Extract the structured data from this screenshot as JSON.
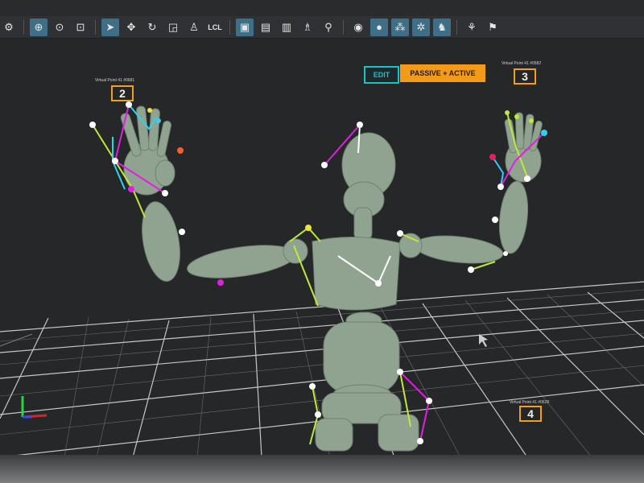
{
  "toolbar": {
    "items": [
      {
        "icon": "joint-icon"
      },
      {
        "icon": "zoom-icon",
        "active": true
      },
      {
        "icon": "zoom-selection-icon"
      },
      {
        "icon": "zoom-fit-icon"
      },
      {
        "icon": "select-arrow-icon",
        "active": true
      },
      {
        "icon": "move-icon"
      },
      {
        "icon": "rotate-icon"
      },
      {
        "icon": "scale-icon"
      },
      {
        "icon": "pose-icon"
      }
    ],
    "lcl_label": "LCL",
    "right_items": [
      {
        "icon": "layer-icon",
        "active": true
      },
      {
        "icon": "layer-lock-icon"
      },
      {
        "icon": "layer-edit-icon"
      },
      {
        "icon": "figure-icon"
      },
      {
        "icon": "link-icon"
      },
      {
        "icon": "eye-icon"
      },
      {
        "icon": "marker-icon",
        "active": true
      },
      {
        "icon": "marker-group-icon",
        "active": true
      },
      {
        "icon": "network-icon",
        "active": true
      },
      {
        "icon": "character-icon",
        "active": true
      },
      {
        "icon": "run-icon"
      },
      {
        "icon": "walk-icon"
      }
    ]
  },
  "modes": {
    "edit_label": "EDIT",
    "passive_label": "PASSIVE + ACTIVE"
  },
  "viewports": [
    {
      "number": "2",
      "caption": "Virtual Point 41 #0681"
    },
    {
      "number": "3",
      "caption": "Virtual Point 41 #0582"
    },
    {
      "number": "4",
      "caption": "Virtual Point 41 #0628"
    }
  ],
  "colors": {
    "accent_cyan": "#17c3c8",
    "accent_orange": "#f39a1a",
    "mannequin": "#8fa390",
    "grid": "#ffffff"
  }
}
